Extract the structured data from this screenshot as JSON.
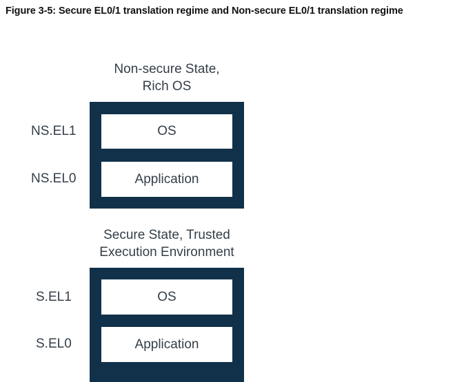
{
  "caption": "Figure 3-5: Secure EL0/1 translation regime and Non-secure EL0/1 translation regime",
  "groups": {
    "nonsecure": {
      "title_line1": "Non-secure State,",
      "title_line2": "Rich OS",
      "upper_label": "NS.EL1",
      "upper_box": "OS",
      "lower_label": "NS.EL0",
      "lower_box": "Application"
    },
    "secure": {
      "title_line1": "Secure State, Trusted",
      "title_line2": "Execution Environment",
      "upper_label": "S.EL1",
      "upper_box": "OS",
      "lower_label": "S.EL0",
      "lower_box": "Application"
    }
  },
  "colors": {
    "frame": "#11314a",
    "text": "#333e48",
    "caption": "#111111"
  }
}
